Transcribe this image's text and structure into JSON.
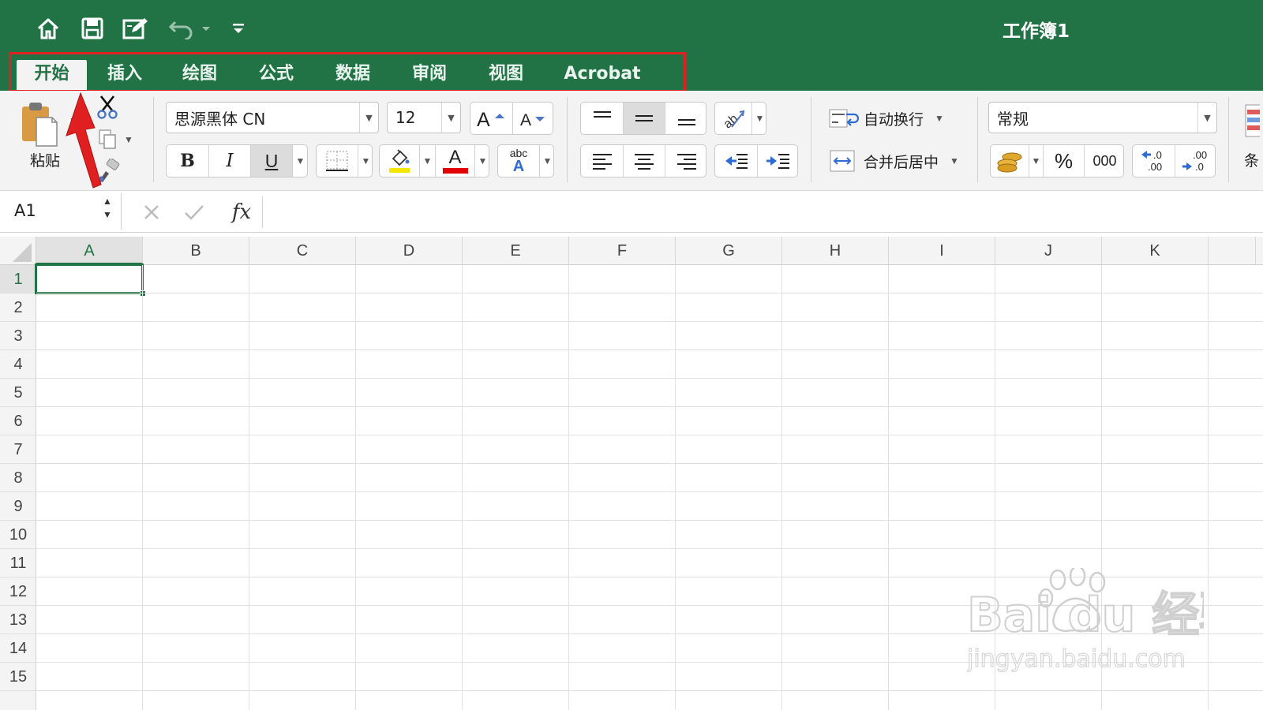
{
  "titlebar": {
    "document_title": "工作簿1",
    "quick_access": [
      {
        "icon": "home-icon"
      },
      {
        "icon": "save-icon"
      },
      {
        "icon": "edit-document-icon"
      },
      {
        "icon": "undo-icon"
      },
      {
        "icon": "customize-toolbar-icon"
      }
    ]
  },
  "tabs": [
    {
      "label": "开始",
      "active": true
    },
    {
      "label": "插入"
    },
    {
      "label": "绘图"
    },
    {
      "label": "公式"
    },
    {
      "label": "数据"
    },
    {
      "label": "审阅"
    },
    {
      "label": "视图"
    },
    {
      "label": "Acrobat"
    }
  ],
  "ribbon": {
    "clipboard": {
      "paste_label": "粘贴"
    },
    "font": {
      "name": "思源黑体 CN",
      "size": "12",
      "bold": "B",
      "italic": "I",
      "underline": "U",
      "font_color_letter": "A",
      "phonetic_top": "abc",
      "phonetic_bottom": "A"
    },
    "alignment": {
      "wrap_text": "自动换行",
      "merge_center": "合并后居中"
    },
    "number": {
      "format": "常规",
      "percent": "%",
      "thousands": "000",
      "increase_decimal": ".0\n.00",
      "decrease_decimal": ".00\n.0"
    },
    "truncated_next_group_label": "条"
  },
  "formula_bar": {
    "name_box": "A1",
    "fx": "fx",
    "content": ""
  },
  "sheet": {
    "columns": [
      "A",
      "B",
      "C",
      "D",
      "E",
      "F",
      "G",
      "H",
      "I",
      "J",
      "K"
    ],
    "rows": [
      "1",
      "2",
      "3",
      "4",
      "5",
      "6",
      "7",
      "8",
      "9",
      "10",
      "11",
      "12",
      "13",
      "14",
      "15"
    ],
    "active_cell": "A1"
  },
  "watermark": {
    "brand": "Bai du 经验",
    "url": "jingyan.baidu.com"
  },
  "colors": {
    "excel_green": "#217346",
    "annotation_red": "#e02020",
    "fill_yellow": "#f4e800",
    "font_red": "#e00000"
  }
}
